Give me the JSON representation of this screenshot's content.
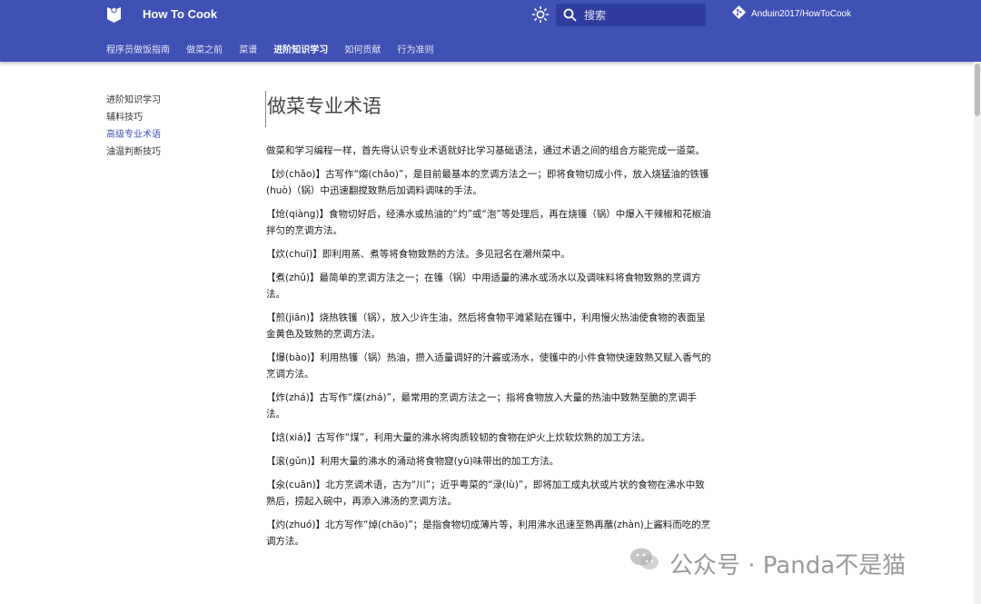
{
  "header": {
    "site_title": "How To Cook",
    "search_placeholder": "搜索",
    "repo_name": "Anduin2017/HowToCook",
    "accent_color": "#4051b5"
  },
  "tabs": [
    {
      "label": "程序员做饭指南",
      "active": false
    },
    {
      "label": "做菜之前",
      "active": false
    },
    {
      "label": "菜谱",
      "active": false
    },
    {
      "label": "进阶知识学习",
      "active": true
    },
    {
      "label": "如何贡献",
      "active": false
    },
    {
      "label": "行为准则",
      "active": false
    }
  ],
  "sidebar": {
    "items": [
      {
        "label": "进阶知识学习",
        "active": false
      },
      {
        "label": "辅料技巧",
        "active": false
      },
      {
        "label": "高级专业术语",
        "active": true
      },
      {
        "label": "油温判断技巧",
        "active": false
      }
    ]
  },
  "content": {
    "title": "做菜专业术语",
    "paragraphs": [
      "做菜和学习编程一样，首先得认识专业术语就好比学习基础语法，通过术语之间的组合方能完成一道菜。",
      "【炒(chǎo)】古写作“煼(chǎo)”，是目前最基本的烹调方法之一；即将食物切成小件，放入烧猛油的铁镬(huò)（锅）中迅速翻搅致熟后加调料调味的手法。",
      "【炝(qiàng)】食物切好后，经沸水或热油的“灼”或“泡”等处理后，再在烧镬（锅）中爆入干辣椒和花椒油拌匀的烹调方法。",
      "【炊(chuī)】即利用蒸、煮等将食物致熟的方法。多见冠名在潮州菜中。",
      "【煮(zhǔ)】最简单的烹调方法之一；在镬（锅）中用适量的沸水或汤水以及调味料将食物致熟的烹调方法。",
      "【煎(jiān)】烧热铁镬（锅），放入少许生油，然后将食物平滩紧贴在镬中，利用慢火热油使食物的表面呈金黄色及致熟的烹调方法。",
      "【爆(bào)】利用热镬（锅）热油，攒入适量调好的汁酱或汤水，使镬中的小件食物快速致熟又赋入香气的烹调方法。",
      "【炸(zhá)】古写作“煠(zhá)”，最常用的烹调方法之一；指将食物放入大量的热油中致熟至脆的烹调手法。",
      "【焓(xiá)】古写作“煤”，利用大量的沸水将肉质较韧的食物在炉火上炊软炊熟的加工方法。",
      "【滚(gǔn)】利用大量的沸水的涌动将食物窟(yū)味带出的加工方法。",
      "【氽(cuān)】北方烹调术语，古为“川”；近乎粤菜的“渌(lù)”，即将加工成丸状或片状的食物在沸水中致熟后，捞起入碗中，再添入沸汤的烹调方法。",
      "【灼(zhuó)】北方写作“焯(chāo)”；是指食物切成薄片等，利用沸水迅速至熟再蘸(zhàn)上酱料而吃的烹调方法。"
    ]
  },
  "watermark": {
    "text": "公众号 · Panda不是猫"
  }
}
